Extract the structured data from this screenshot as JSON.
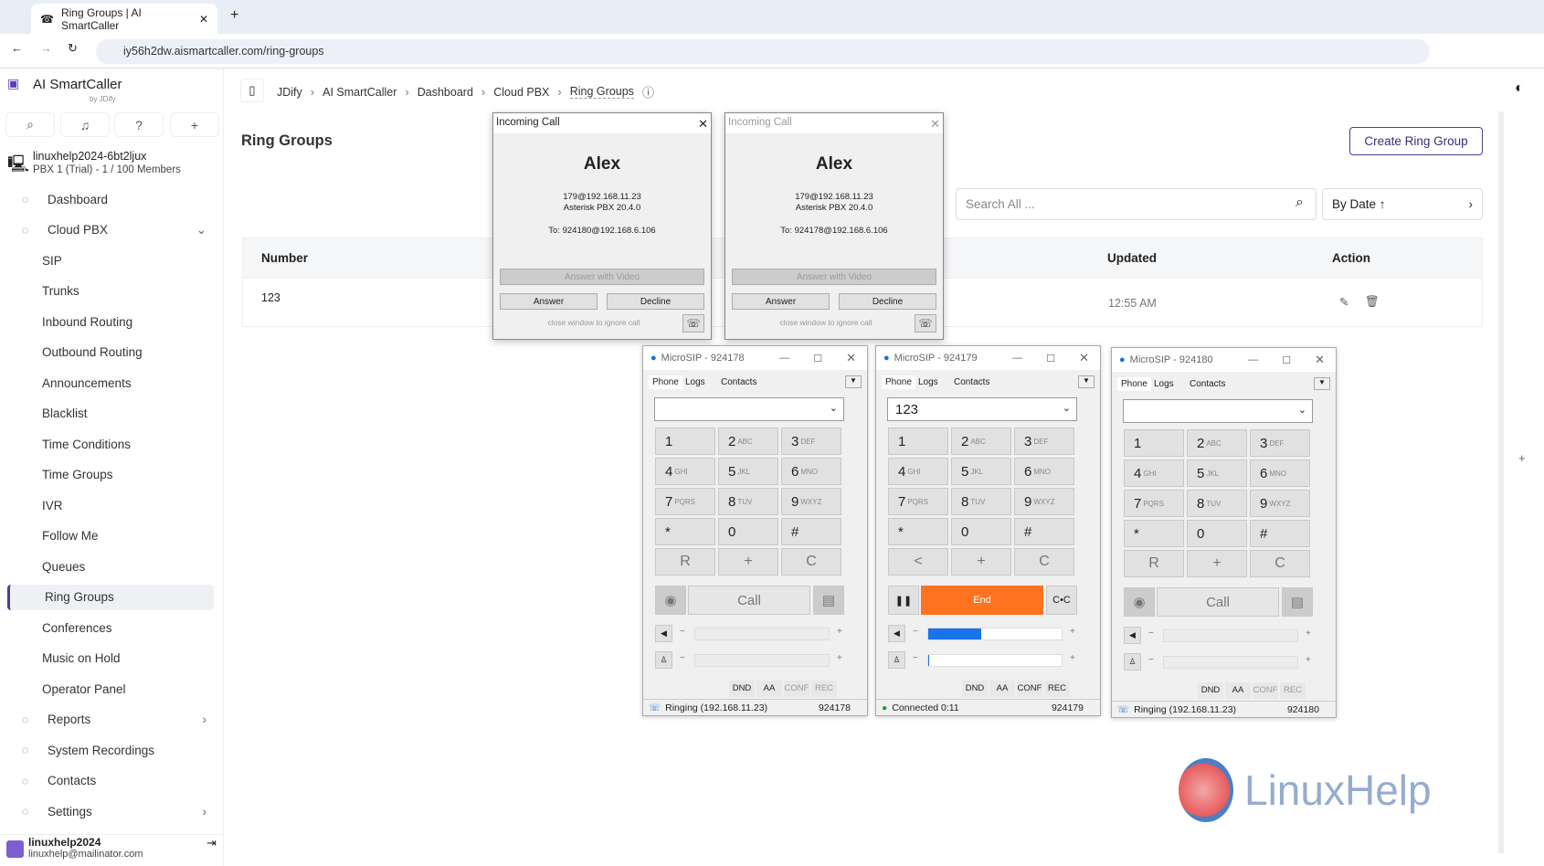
{
  "browser": {
    "tab_title": "Ring Groups | AI SmartCaller",
    "url": "iy56h2dw.aismartcaller.com/ring-groups"
  },
  "app": {
    "name": "AI SmartCaller",
    "by": "by JDify",
    "workspace": "linuxhelp2024-6bt2ljux",
    "plan": "PBX 1 (Trial) - 1 / 100 Members"
  },
  "breadcrumb": [
    "JDify",
    "AI SmartCaller",
    "Dashboard",
    "Cloud PBX",
    "Ring Groups"
  ],
  "nav": [
    {
      "label": "Dashboard",
      "icon": "dashboard-icon"
    },
    {
      "label": "Cloud PBX",
      "icon": "cloud-icon",
      "expanded": true
    },
    {
      "label": "SIP",
      "sub": true
    },
    {
      "label": "Trunks",
      "sub": true
    },
    {
      "label": "Inbound Routing",
      "sub": true
    },
    {
      "label": "Outbound Routing",
      "sub": true
    },
    {
      "label": "Announcements",
      "sub": true
    },
    {
      "label": "Blacklist",
      "sub": true
    },
    {
      "label": "Time Conditions",
      "sub": true
    },
    {
      "label": "Time Groups",
      "sub": true
    },
    {
      "label": "IVR",
      "sub": true
    },
    {
      "label": "Follow Me",
      "sub": true
    },
    {
      "label": "Queues",
      "sub": true
    },
    {
      "label": "Ring Groups",
      "sub": true,
      "active": true
    },
    {
      "label": "Conferences",
      "sub": true
    },
    {
      "label": "Music on Hold",
      "sub": true
    },
    {
      "label": "Operator Panel",
      "sub": true
    },
    {
      "label": "Reports",
      "icon": "reports-icon",
      "chevron": true
    },
    {
      "label": "System Recordings",
      "icon": "mic-icon"
    },
    {
      "label": "Contacts",
      "icon": "contacts-icon"
    },
    {
      "label": "Settings",
      "icon": "gear-icon",
      "chevron": true
    }
  ],
  "user": {
    "name": "linuxhelp2024",
    "email": "linuxhelp@mailinator.com"
  },
  "page": {
    "title": "Ring Groups",
    "create": "Create Ring Group",
    "search_placeholder": "Search All ...",
    "sort": "By Date ↑",
    "columns": {
      "number": "Number",
      "updated": "Updated",
      "action": "Action"
    },
    "rows": [
      {
        "number": "123",
        "updated": "12:55 AM"
      }
    ]
  },
  "incoming": [
    {
      "title": "Incoming Call",
      "name": "Alex",
      "from": "179@192.168.11.23",
      "server": "Asterisk PBX 20.4.0",
      "to": "To: 924180@192.168.6.106",
      "video": "Answer with Video",
      "answer": "Answer",
      "decline": "Decline",
      "hint": "close window to ignore call"
    },
    {
      "title": "Incoming Call",
      "name": "Alex",
      "from": "179@192.168.11.23",
      "server": "Asterisk PBX 20.4.0",
      "to": "To: 924178@192.168.6.106",
      "video": "Answer with Video",
      "answer": "Answer",
      "decline": "Decline",
      "hint": "close window to ignore call"
    }
  ],
  "microsip": [
    {
      "title": "MicroSIP - 924178",
      "dial": "",
      "mode": "call",
      "call": "Call",
      "status": "Ringing (192.168.11.23)",
      "account": "924178",
      "speaker_level": 0,
      "mic_level": 0
    },
    {
      "title": "MicroSIP - 924179",
      "dial": "123",
      "mode": "end",
      "call": "End",
      "status": "Connected 0:11",
      "account": "924179",
      "speaker_level": 0.4,
      "mic_level": 0.01
    },
    {
      "title": "MicroSIP - 924180",
      "dial": "",
      "mode": "call",
      "call": "Call",
      "status": "Ringing (192.168.11.23)",
      "account": "924180",
      "speaker_level": 0,
      "mic_level": 0
    }
  ],
  "microsip_tabs": [
    "Phone",
    "Logs",
    "Contacts"
  ],
  "keys": [
    [
      "1",
      ""
    ],
    [
      "2",
      "ABC"
    ],
    [
      "3",
      "DEF"
    ],
    [
      "4",
      "GHI"
    ],
    [
      "5",
      "JKL"
    ],
    [
      "6",
      "MNO"
    ],
    [
      "7",
      "PQRS"
    ],
    [
      "8",
      "TUV"
    ],
    [
      "9",
      "WXYZ"
    ],
    [
      "*",
      ""
    ],
    [
      "0",
      ""
    ],
    [
      "#",
      ""
    ]
  ],
  "flags": [
    "DND",
    "AA",
    "CONF",
    "REC"
  ],
  "watermark": "LinuxHelp",
  "colors": {
    "accent": "#4b3f8f",
    "end": "#ff7220",
    "level": "#1a73e8"
  }
}
